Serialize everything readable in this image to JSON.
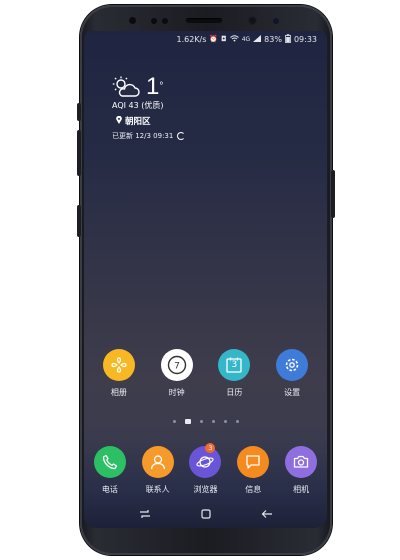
{
  "status_bar": {
    "speed": "1.62K/s",
    "network": "4G",
    "battery": "83%",
    "time": "09:33"
  },
  "weather": {
    "temperature": "1",
    "degree_symbol": "°",
    "aqi": "AQI 43 (优质)",
    "location": "朝阳区",
    "updated": "已更新 12/3 09:31"
  },
  "apps_row1": [
    {
      "label": "相册",
      "icon": "gallery-icon",
      "color": "#f7b824"
    },
    {
      "label": "时钟",
      "icon": "clock-icon",
      "color": "#ffffff"
    },
    {
      "label": "日历",
      "icon": "calendar-icon",
      "color": "#33b7c9",
      "day": "3"
    },
    {
      "label": "设置",
      "icon": "settings-gear-icon",
      "color": "#3f7bd9"
    }
  ],
  "apps_row2": [
    {
      "label": "电话",
      "icon": "phone-icon",
      "color": "#2dbf63"
    },
    {
      "label": "联系人",
      "icon": "contacts-icon",
      "color": "#f59a2b"
    },
    {
      "label": "浏览器",
      "icon": "browser-icon",
      "color": "#6a55d8",
      "badge": "3"
    },
    {
      "label": "信息",
      "icon": "messages-icon",
      "color": "#f58a1f"
    },
    {
      "label": "相机",
      "icon": "camera-icon",
      "color": "#8f6fe0"
    }
  ],
  "page_dots": 5
}
